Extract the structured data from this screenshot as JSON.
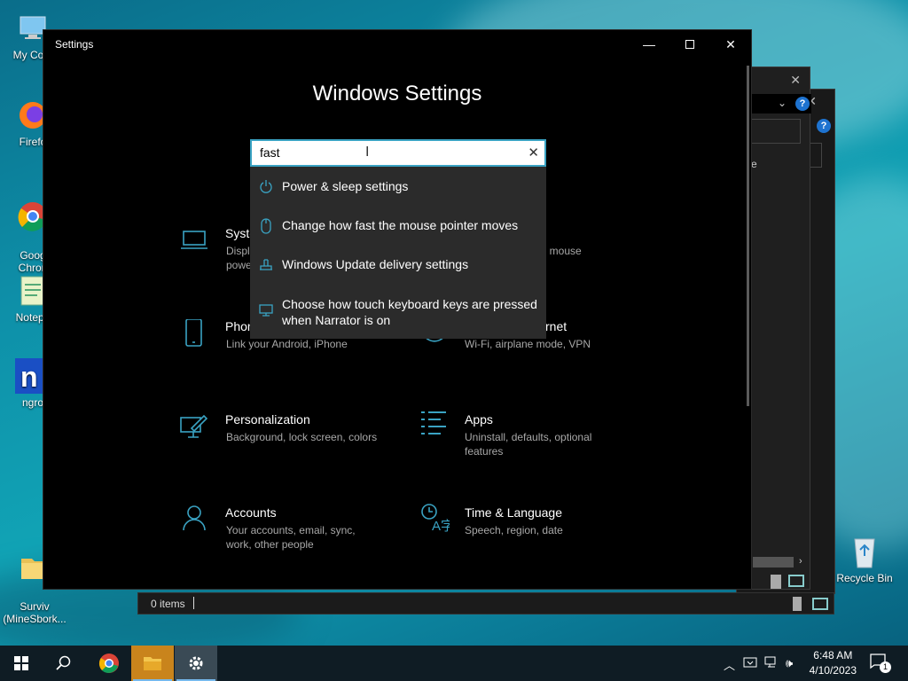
{
  "desktop": {
    "icons": [
      {
        "label": "My Com"
      },
      {
        "label": "Firefo"
      },
      {
        "label": "Goog\nChron"
      },
      {
        "label": "Notepa"
      },
      {
        "label": "ngro"
      },
      {
        "label": "Surviv\n(MineSbork..."
      },
      {
        "label": "Recycle Bin"
      }
    ]
  },
  "explorer": {
    "status_text": "0 items",
    "partial_text": "e"
  },
  "settings_window": {
    "title": "Settings",
    "heading": "Windows Settings",
    "search": {
      "value": "fast"
    },
    "suggestions": [
      {
        "label": "Power & sleep settings",
        "icon": "power-icon"
      },
      {
        "label": "Change how fast the mouse pointer moves",
        "icon": "mouse-icon"
      },
      {
        "label": "Windows Update delivery settings",
        "icon": "delivery-icon"
      },
      {
        "label": "Choose how touch keyboard keys are pressed when Narrator is on",
        "icon": "narrator-icon"
      }
    ],
    "categories": [
      {
        "name": "Syste",
        "desc": "Displ\npowe",
        "icon": "laptop-icon"
      },
      {
        "name": "",
        "desc": ", mouse",
        "icon": "devices-icon"
      },
      {
        "name": "Phon",
        "desc": "Link your Android, iPhone",
        "icon": "phone-icon"
      },
      {
        "name": "rnet",
        "desc": "Wi-Fi, airplane mode, VPN",
        "icon": "globe-icon"
      },
      {
        "name": "Personalization",
        "desc": "Background, lock screen, colors",
        "icon": "personalization-icon"
      },
      {
        "name": "Apps",
        "desc": "Uninstall, defaults, optional features",
        "icon": "apps-icon"
      },
      {
        "name": "Accounts",
        "desc": "Your accounts, email, sync, work, other people",
        "icon": "accounts-icon"
      },
      {
        "name": "Time & Language",
        "desc": "Speech, region, date",
        "icon": "time-language-icon"
      }
    ]
  },
  "taskbar": {
    "items": [
      "start-icon",
      "search-icon",
      "chrome-icon",
      "file-explorer-icon",
      "settings-icon"
    ],
    "clock": {
      "time": "6:48 AM",
      "date": "4/10/2023"
    },
    "notification_count": "1"
  },
  "colors": {
    "accent": "#3aa3c3",
    "background": "#000000"
  }
}
